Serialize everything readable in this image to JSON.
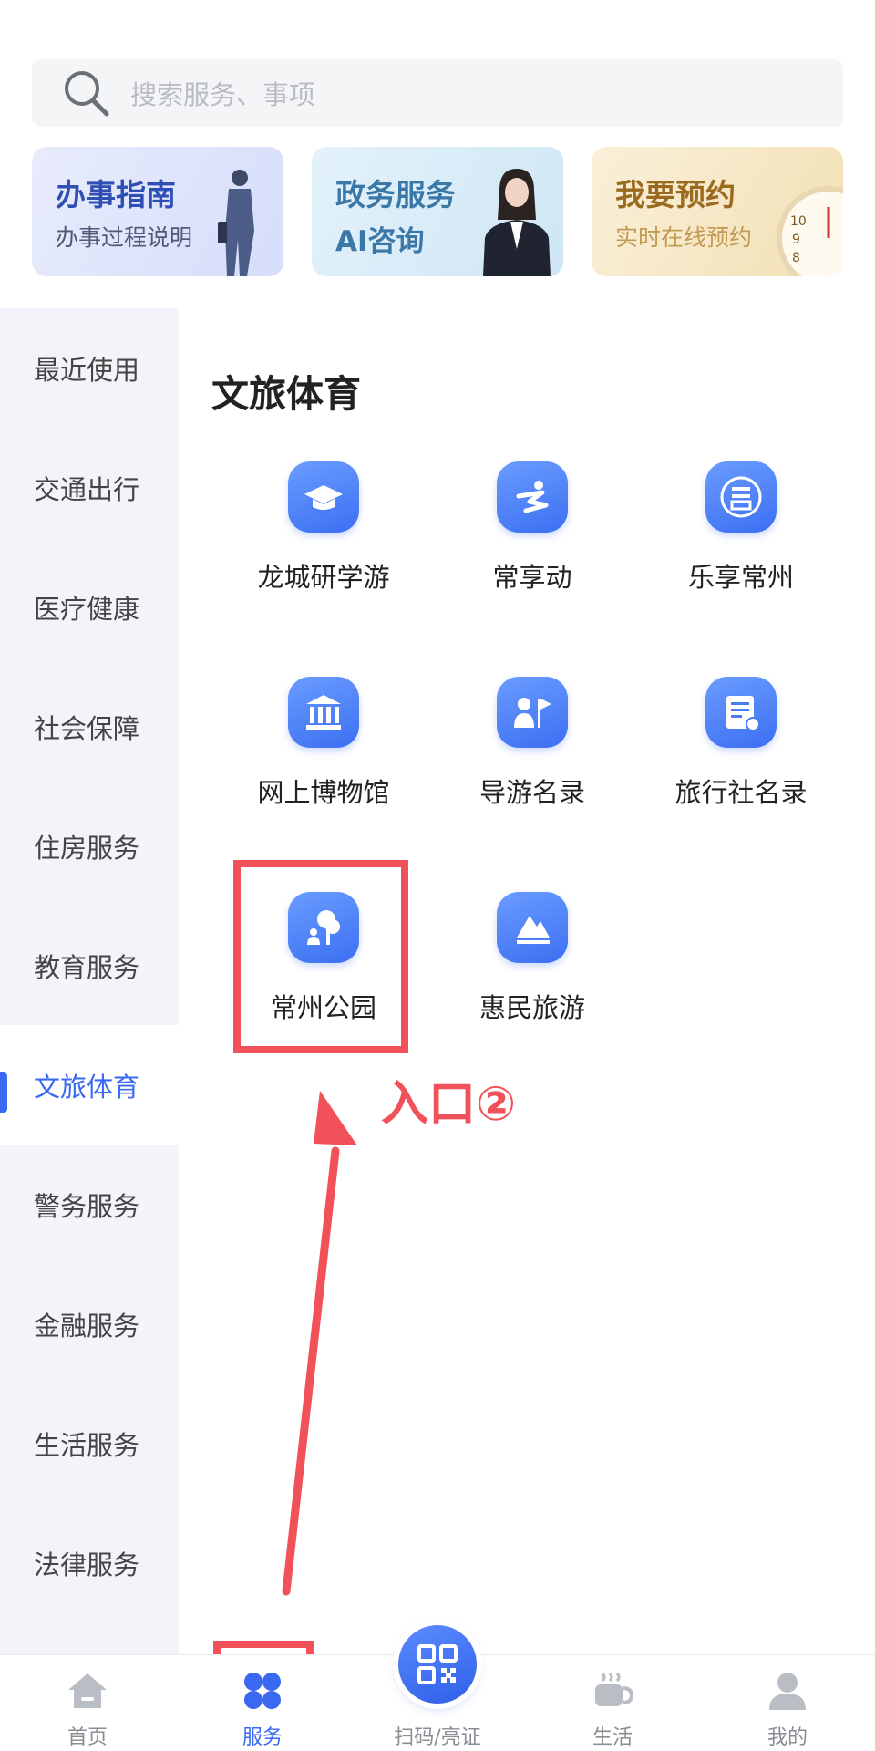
{
  "search": {
    "placeholder": "搜索服务、事项"
  },
  "cards": [
    {
      "title": "办事指南",
      "subtitle": "办事过程说明"
    },
    {
      "title": "政务服务",
      "subtitle": "AI咨询"
    },
    {
      "title": "我要预约",
      "subtitle": "实时在线预约"
    }
  ],
  "sidebar": {
    "items": [
      {
        "label": "最近使用"
      },
      {
        "label": "交通出行"
      },
      {
        "label": "医疗健康"
      },
      {
        "label": "社会保障"
      },
      {
        "label": "住房服务"
      },
      {
        "label": "教育服务"
      },
      {
        "label": "文旅体育",
        "active": true
      },
      {
        "label": "警务服务"
      },
      {
        "label": "金融服务"
      },
      {
        "label": "生活服务"
      },
      {
        "label": "法律服务"
      }
    ]
  },
  "section": {
    "title": "文旅体育",
    "tiles": [
      {
        "label": "龙城研学游",
        "icon": "graduation-cap-icon"
      },
      {
        "label": "常享动",
        "icon": "sport-runner-icon"
      },
      {
        "label": "乐享常州",
        "icon": "city-emblem-icon"
      },
      {
        "label": "网上博物馆",
        "icon": "museum-icon"
      },
      {
        "label": "导游名录",
        "icon": "tour-guide-flag-icon"
      },
      {
        "label": "旅行社名录",
        "icon": "agency-list-icon"
      },
      {
        "label": "常州公园",
        "icon": "park-tree-icon"
      },
      {
        "label": "惠民旅游",
        "icon": "mountain-icon"
      }
    ]
  },
  "annotation": {
    "text": "入口②",
    "color": "#f1525a"
  },
  "bottom_nav": {
    "items": [
      {
        "label": "首页",
        "icon": "home-icon"
      },
      {
        "label": "服务",
        "icon": "services-grid-icon",
        "active": true
      },
      {
        "label": "扫码/亮证",
        "icon": "qr-code-icon"
      },
      {
        "label": "生活",
        "icon": "coffee-cup-icon"
      },
      {
        "label": "我的",
        "icon": "user-icon"
      }
    ]
  },
  "colors": {
    "accent": "#3a68f0",
    "annotation": "#f1525a",
    "sidebar_bg": "#f3f4f9"
  }
}
